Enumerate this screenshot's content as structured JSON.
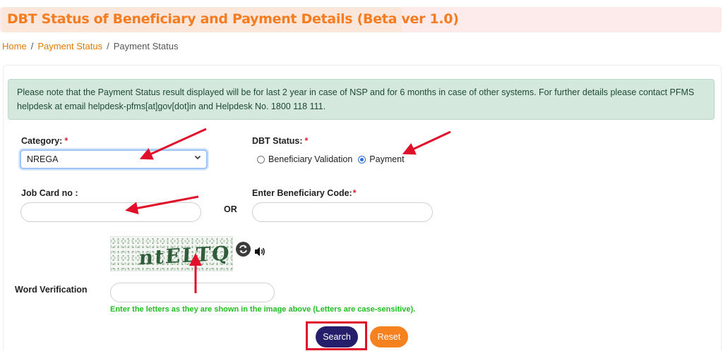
{
  "header": {
    "title": "DBT Status of Beneficiary and Payment Details (Beta ver 1.0)"
  },
  "breadcrumb": {
    "items": [
      "Home",
      "Payment Status",
      "Payment Status"
    ],
    "separator": "/"
  },
  "notice": {
    "text": "Please note that the Payment Status result displayed will be for last 2 year in case of NSP and for 6 months in case of other systems. For further details please contact PFMS helpdesk at email helpdesk-pfms[at]gov[dot]in and Helpdesk No. 1800 118 111."
  },
  "form": {
    "category": {
      "label": "Category:",
      "required_mark": "*",
      "selected": "NREGA"
    },
    "dbt_status": {
      "label": "DBT Status:",
      "required_mark": "*",
      "options": [
        "Beneficiary Validation",
        "Payment"
      ],
      "selected": "Payment"
    },
    "job_card": {
      "label": "Job Card no :",
      "value": ""
    },
    "or_text": "OR",
    "beneficiary_code": {
      "label": "Enter Beneficiary Code:",
      "required_mark": "*",
      "value": ""
    },
    "captcha": {
      "text": "ntELTQ"
    },
    "word_verification": {
      "label": "Word Verification",
      "value": "",
      "hint": "Enter the letters as they are shown in the image above (Letters are case-sensitive)."
    },
    "buttons": {
      "search": "Search",
      "reset": "Reset"
    }
  },
  "colors": {
    "title": "#f57c1f",
    "link": "#e07b00",
    "search_button": "#251f6b",
    "reset_button": "#f5811f",
    "hint": "#1fbf1f",
    "annotation": "#e0102a"
  },
  "icons": {
    "captcha_refresh": "refresh-icon",
    "captcha_audio": "speaker-icon",
    "select_chevron": "chevron-down-icon"
  }
}
